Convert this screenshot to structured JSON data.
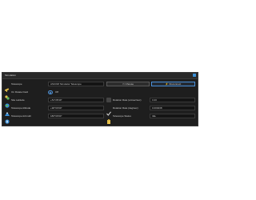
{
  "panel": {
    "title": "Simulation"
  },
  "rows": {
    "telescope": {
      "label": "Telescope",
      "value": "ASCOM Simulator Telescope",
      "choose_label": "Choose",
      "disconnect_label": "Disconnect"
    },
    "on_rotate_field": {
      "label": "On Rotate Field",
      "toggle_state": "Off"
    },
    "site_latitude": {
      "label": "Site Latitude",
      "value": "+51°28'40\""
    },
    "rotation_rate_arcsec": {
      "label": "Rotation Rate (arcsec/sec)",
      "value": "3.43"
    },
    "telescope_altitude": {
      "label": "Telescope Altitude",
      "value": "+90°00'00\""
    },
    "rotation_rate_deg": {
      "label": "Rotation Rate (deg/sec)",
      "value": "0.000238"
    },
    "telescope_azimuth": {
      "label": "Telescope Azimuth",
      "value": "180°00'00\""
    },
    "telescope_status": {
      "label": "Telescope Status",
      "value": "Idle"
    }
  },
  "colors": {
    "panel_bg": "#1e1e1e",
    "accent": "#4a90d9",
    "icon_yellow": "#e6c04a",
    "icon_green": "#5cb85c"
  },
  "icons": {
    "telescope": "telescope-icon",
    "rotate": "rotate-icon",
    "latitude": "globe-icon",
    "altitude": "mountain-icon",
    "azimuth": "compass-icon",
    "rate_arcsec": "rate-icon",
    "rate_deg": "check-icon",
    "status": "clipboard-icon",
    "choose": "folder-icon",
    "disconnect": "plug-icon"
  }
}
